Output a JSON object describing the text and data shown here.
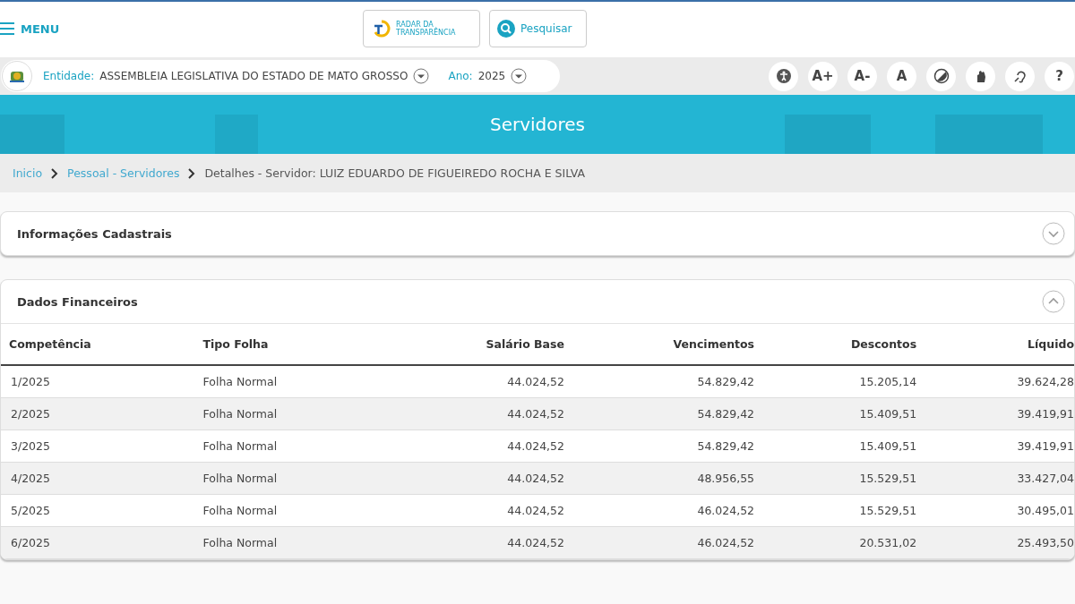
{
  "header": {
    "menu_label": "MENU",
    "radar_label": [
      "RADAR DA",
      "TRANSPARÊNCIA"
    ],
    "search_label": "Pesquisar"
  },
  "filters": {
    "entity_label": "Entidade:",
    "entity_value": "ASSEMBLEIA LEGISLATIVA DO ESTADO DE MATO GROSSO",
    "year_label": "Ano:",
    "year_value": "2025"
  },
  "accessibility_buttons": [
    {
      "kind": "person"
    },
    {
      "kind": "text",
      "text": "A+"
    },
    {
      "kind": "text",
      "text": "A-"
    },
    {
      "kind": "text",
      "text": "A"
    },
    {
      "kind": "contrast"
    },
    {
      "kind": "hand"
    },
    {
      "kind": "ear"
    },
    {
      "kind": "text",
      "text": "?"
    }
  ],
  "banner": {
    "title": "Servidores"
  },
  "breadcrumb": [
    {
      "kind": "link",
      "text": "Inicio"
    },
    {
      "kind": "link",
      "text": "Pessoal - Servidores"
    },
    {
      "kind": "current",
      "text": "Detalhes - Servidor: LUIZ EDUARDO DE FIGUEIREDO ROCHA E SILVA"
    }
  ],
  "sections": [
    {
      "title": "Informações Cadastrais",
      "expanded": false
    },
    {
      "title": "Dados Financeiros",
      "expanded": true,
      "table": {
        "columns": [
          "Competência",
          "Tipo Folha",
          "Salário Base",
          "Vencimentos",
          "Descontos",
          "Líquido"
        ],
        "rows": [
          [
            "1/2025",
            "Folha Normal",
            "44.024,52",
            "54.829,42",
            "15.205,14",
            "39.624,28"
          ],
          [
            "2/2025",
            "Folha Normal",
            "44.024,52",
            "54.829,42",
            "15.409,51",
            "39.419,91"
          ],
          [
            "3/2025",
            "Folha Normal",
            "44.024,52",
            "54.829,42",
            "15.409,51",
            "39.419,91"
          ],
          [
            "4/2025",
            "Folha Normal",
            "44.024,52",
            "48.956,55",
            "15.529,51",
            "33.427,04"
          ],
          [
            "5/2025",
            "Folha Normal",
            "44.024,52",
            "46.024,52",
            "15.529,51",
            "30.495,01"
          ],
          [
            "6/2025",
            "Folha Normal",
            "44.024,52",
            "46.024,52",
            "20.531,02",
            "25.493,50"
          ]
        ]
      }
    }
  ]
}
